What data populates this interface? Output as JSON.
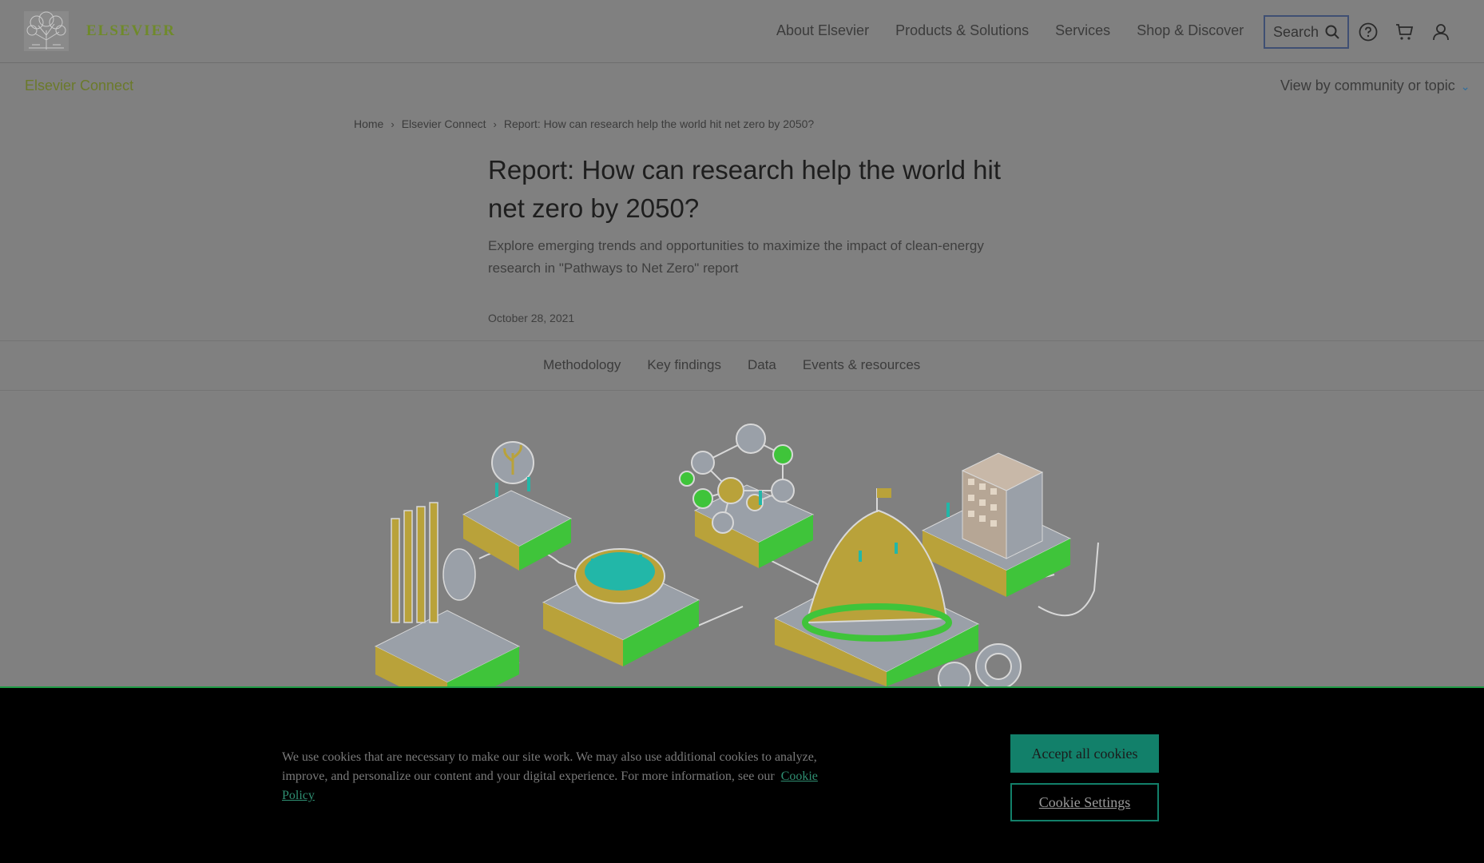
{
  "header": {
    "brand": "ELSEVIER",
    "nav": [
      "About Elsevier",
      "Products & Solutions",
      "Services",
      "Shop & Discover"
    ],
    "search_label": "Search",
    "icons": [
      "help-icon",
      "cart-icon",
      "account-icon"
    ]
  },
  "subbar": {
    "section": "Elsevier Connect",
    "view_by": "View by community or topic"
  },
  "breadcrumb": [
    "Home",
    "Elsevier Connect",
    "Report: How can research help the world hit net zero by 2050?"
  ],
  "article": {
    "title": "Report: How can research help the world hit net zero by 2050?",
    "lede": "Explore emerging trends and opportunities to maximize the impact of clean-energy research in \"Pathways to Net Zero\" report",
    "date": "October 28, 2021"
  },
  "tabs": [
    "Methodology",
    "Key findings",
    "Data",
    "Events & resources"
  ],
  "cookie_banner": {
    "text": "We use cookies that are necessary to make our site work. We may also use additional cookies to analyze, improve, and personalize our content and your digital experience. For more information, see our",
    "policy_link": "Cookie Policy",
    "accept_label": "Accept all cookies",
    "settings_label": "Cookie Settings"
  },
  "colors": {
    "page_bg": "#808080",
    "brand_green": "#6f8a2a",
    "accent_teal": "#12806a",
    "illustration_green": "#3fc43a",
    "illustration_gold": "#b9a23a"
  }
}
